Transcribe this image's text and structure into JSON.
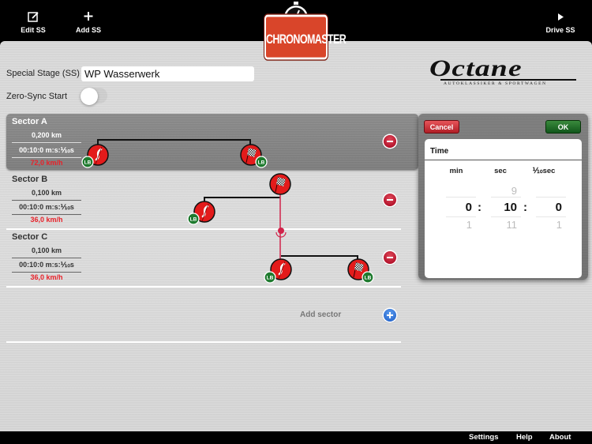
{
  "toolbar": {
    "edit_label": "Edit SS",
    "add_label": "Add SS",
    "drive_label": "Drive SS",
    "edit_icon": "edit-icon",
    "add_icon": "plus-icon",
    "drive_icon": "play-icon"
  },
  "logo": {
    "app_name": "CHRONOMASTER",
    "sponsor": "Octane",
    "sponsor_tagline": "AUTOKLASSIKER & SPORTWAGEN"
  },
  "stage": {
    "label": "Special Stage (SS)",
    "value": "WP Wasserwerk",
    "zero_sync_label": "Zero-Sync Start",
    "zero_sync_on": false
  },
  "sectors": [
    {
      "name": "Sector A",
      "distance": "0,200 km",
      "time": "00:10:0 m:s:⅒s",
      "speed": "72,0 km/h",
      "start_badge": "LB",
      "finish_badge": "LB",
      "selected": true
    },
    {
      "name": "Sector B",
      "distance": "0,100 km",
      "time": "00:10:0 m:s:⅒s",
      "speed": "36,0 km/h",
      "start_badge": "LB",
      "selected": false
    },
    {
      "name": "Sector C",
      "distance": "0,100 km",
      "time": "00:10:0 m:s:⅒s",
      "speed": "36,0 km/h",
      "start_badge": "LB",
      "finish_badge": "LB",
      "selected": false
    }
  ],
  "add_sector_label": "Add sector",
  "time_picker": {
    "cancel_label": "Cancel",
    "ok_label": "OK",
    "title": "Time",
    "columns": [
      {
        "label": "min",
        "prev": "",
        "selected": "0",
        "next": "1"
      },
      {
        "label": "sec",
        "prev": "9",
        "selected": "10",
        "next": "11"
      },
      {
        "label": "⅒sec",
        "prev": "",
        "selected": "0",
        "next": "1"
      }
    ],
    "separator": ":"
  },
  "footer": {
    "settings_label": "Settings",
    "help_label": "Help",
    "about_label": "About"
  },
  "colors": {
    "speed_red": "#e8222a",
    "cancel_red": "#b01e26",
    "ok_green": "#10561a",
    "logo_red": "#d9452a",
    "badge_green": "#1e7a2e"
  }
}
